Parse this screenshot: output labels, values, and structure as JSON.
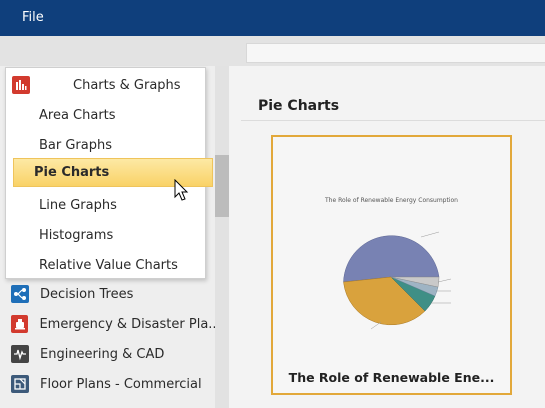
{
  "menu": {
    "file_label": "File"
  },
  "categories": [
    {
      "label": "Decision Trees",
      "icon": "decision-tree-icon",
      "color": "#1f6fb8"
    },
    {
      "label": "Emergency & Disaster Pla...",
      "icon": "emergency-icon",
      "color": "#d23a2e"
    },
    {
      "label": "Engineering & CAD",
      "icon": "waveform-icon",
      "color": "#444444"
    },
    {
      "label": "Floor Plans - Commercial",
      "icon": "floor-plan-icon",
      "color": "#3d5a7a"
    }
  ],
  "dropdown": {
    "header": {
      "label": "Charts & Graphs",
      "icon": "bar-chart-icon",
      "color": "#d23a2e"
    },
    "items": [
      {
        "label": "Area Charts"
      },
      {
        "label": "Bar Graphs"
      },
      {
        "label": "Pie Charts",
        "selected": true
      },
      {
        "label": "Line Graphs"
      },
      {
        "label": "Histograms"
      },
      {
        "label": "Relative Value Charts"
      }
    ]
  },
  "content": {
    "section_title": "Pie Charts",
    "template": {
      "caption": "The Role of Renewable  Ene...",
      "thumbnail_title": "The Role of Renewable Energy Consumption",
      "border_color": "#e2a83a"
    }
  }
}
